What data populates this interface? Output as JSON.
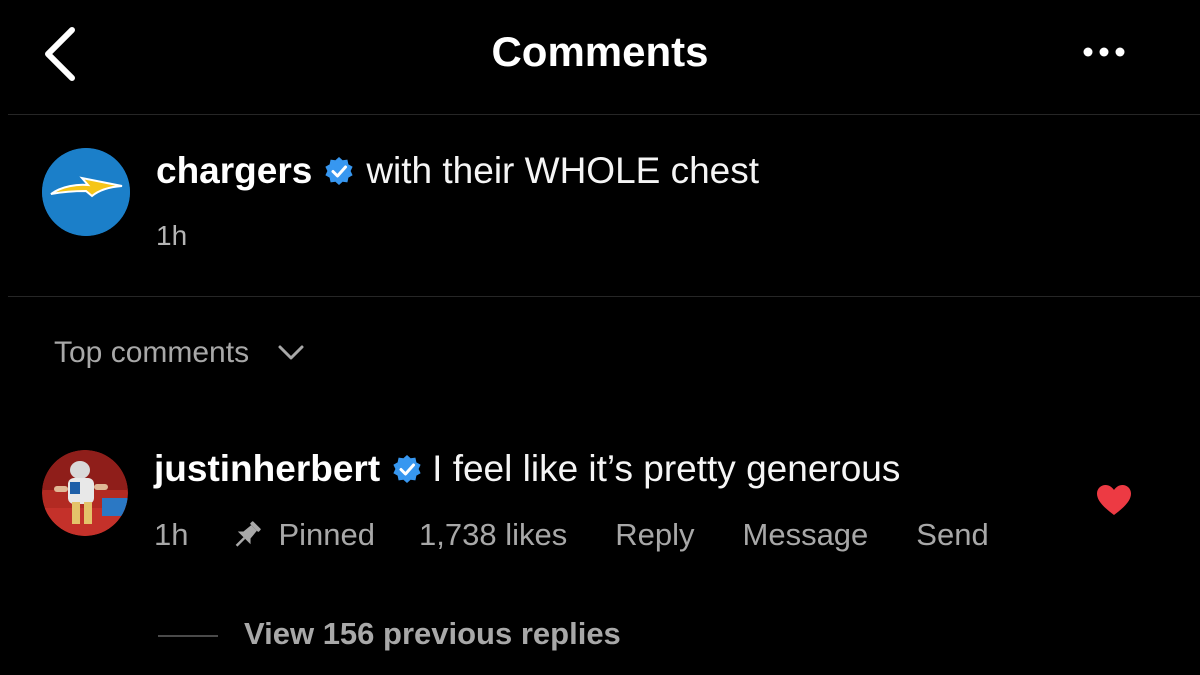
{
  "header": {
    "title": "Comments",
    "back_icon": "chevron-left-icon",
    "more_icon": "more-horizontal-icon"
  },
  "caption": {
    "username": "chargers",
    "verified": true,
    "text": "with their WHOLE chest",
    "time": "1h",
    "avatar_color": "#1b7fc9"
  },
  "sort": {
    "label": "Top comments",
    "icon": "chevron-down-icon"
  },
  "comments": [
    {
      "username": "justinherbert",
      "verified": true,
      "text": "I feel like it’s pretty generous",
      "time": "1h",
      "pinned_label": "Pinned",
      "likes": "1,738 likes",
      "reply_label": "Reply",
      "message_label": "Message",
      "send_label": "Send",
      "liked": true,
      "heart_color": "#ed3a43",
      "view_replies": "View 156 previous replies"
    }
  ],
  "colors": {
    "background": "#000000",
    "verified_badge": "#3797f0",
    "secondary_text": "#a8a8a8"
  }
}
